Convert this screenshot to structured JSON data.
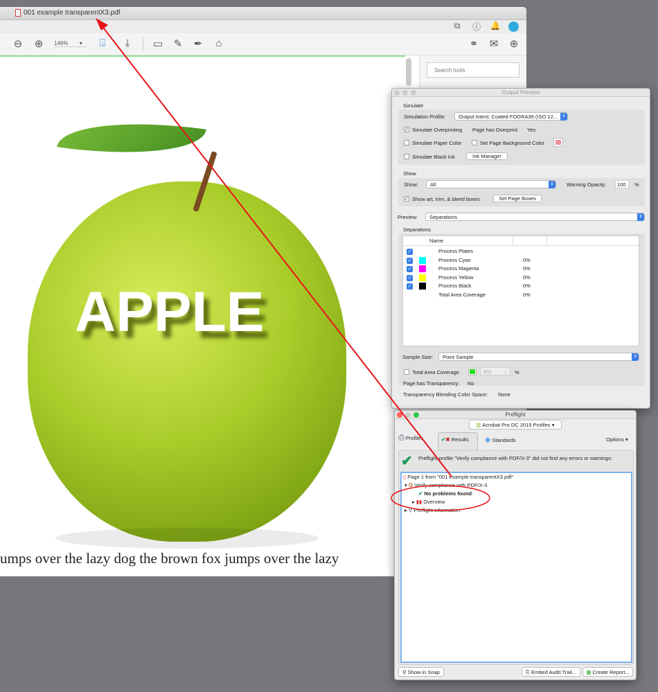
{
  "acrobat": {
    "title": "001 example transparentX3.pdf",
    "zoom": "146%",
    "search_placeholder": "Search tools",
    "apple_text": "APPLE",
    "body_text": "umps over the lazy dog the brown fox jumps over the lazy"
  },
  "output_preview": {
    "title": "Output Preview",
    "simulate_heading": "Simulate",
    "simulation_profile_label": "Simulation Profile:",
    "simulation_profile_value": "Output Intent: Coated FOGRA39 (ISO 12...",
    "simulate_overprinting": "Simulate Overprinting",
    "page_has_overprint_label": "Page has Overprint:",
    "page_has_overprint_value": "Yes",
    "simulate_paper_color": "Simulate Paper Color",
    "set_page_bg_color": "Set Page Background Color",
    "simulate_black_ink": "Simulate Black Ink",
    "ink_manager": "Ink Manager",
    "show_heading": "Show",
    "show_label": "Show:",
    "show_value": "All",
    "warning_opacity_label": "Warning Opacity:",
    "warning_opacity_value": "100",
    "percent": "%",
    "show_boxes": "Show art, trim, & bleed boxes",
    "set_page_boxes": "Set Page Boxes",
    "preview_label": "Preview:",
    "preview_value": "Separations",
    "separations_heading": "Separations",
    "col_name": "Name",
    "separations": [
      {
        "name": "Process Plates",
        "value": "",
        "color": ""
      },
      {
        "name": "Process Cyan",
        "value": "0%",
        "color": "#00ffff"
      },
      {
        "name": "Process Magenta",
        "value": "0%",
        "color": "#ff00ff"
      },
      {
        "name": "Process Yellow",
        "value": "0%",
        "color": "#ffff00"
      },
      {
        "name": "Process Black",
        "value": "0%",
        "color": "#000000"
      },
      {
        "name": "Total Area Coverage",
        "value": "0%",
        "color": ""
      }
    ],
    "sample_size_label": "Sample Size:",
    "sample_size_value": "Point Sample",
    "total_area_coverage": "Total Area Coverage",
    "tac_value": "302",
    "transparency_label": "Page has Transparency:",
    "transparency_value": "No",
    "blending_label": "Transparency Blending Color Space:",
    "blending_value": "None"
  },
  "preflight": {
    "title": "Preflight",
    "profiles_dropdown": "Acrobat Pro DC 2015 Profiles",
    "tabs": [
      "Profiles",
      "Results",
      "Standards"
    ],
    "options": "Options",
    "summary": "Preflight profile \"Verify compliance with PDF/X-3\" did not find any errors or warnings:",
    "tree": [
      "Page 1 from \"001 example transparentX3.pdf\"",
      "Verify compliance with PDF/X-3",
      "No problems found",
      "Overview",
      "Preflight information"
    ],
    "show_in_snap": "Show in Snap",
    "embed_audit_trail": "Embed Audit Trail...",
    "create_report": "Create Report..."
  }
}
